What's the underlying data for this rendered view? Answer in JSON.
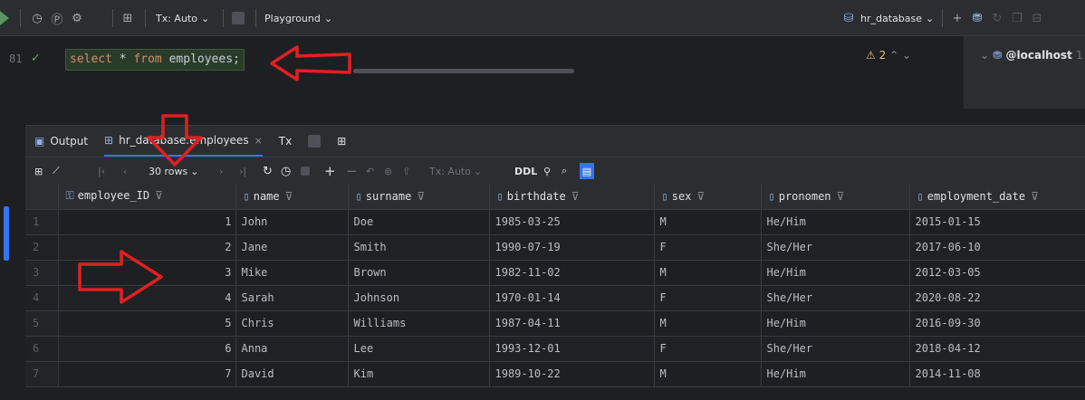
{
  "toolbar": {
    "tx_mode": "Tx: Auto",
    "playground": "Playground",
    "database": "hr_database"
  },
  "editor": {
    "line_number": "81",
    "query": {
      "kw1": "select",
      "star": " * ",
      "kw2": "from",
      "table": " employees",
      "semi": ";"
    },
    "warning_count": "2"
  },
  "right_panel": {
    "host": "@localhost",
    "host_suffix": "1"
  },
  "results": {
    "tabs": {
      "output": "Output",
      "table": "hr_database.employees",
      "tx": "Tx"
    },
    "toolbar": {
      "rows": "30 rows",
      "tx_mode": "Tx: Auto",
      "ddl": "DDL"
    },
    "columns": [
      "employee_ID",
      "name",
      "surname",
      "birthdate",
      "sex",
      "pronomen",
      "employment_date"
    ],
    "rows": [
      {
        "n": "1",
        "id": "1",
        "name": "John",
        "surname": "Doe",
        "birthdate": "1985-03-25",
        "sex": "M",
        "pronomen": "He/Him",
        "employment_date": "2015-01-15"
      },
      {
        "n": "2",
        "id": "2",
        "name": "Jane",
        "surname": "Smith",
        "birthdate": "1990-07-19",
        "sex": "F",
        "pronomen": "She/Her",
        "employment_date": "2017-06-10"
      },
      {
        "n": "3",
        "id": "3",
        "name": "Mike",
        "surname": "Brown",
        "birthdate": "1982-11-02",
        "sex": "M",
        "pronomen": "He/Him",
        "employment_date": "2012-03-05"
      },
      {
        "n": "4",
        "id": "4",
        "name": "Sarah",
        "surname": "Johnson",
        "birthdate": "1970-01-14",
        "sex": "F",
        "pronomen": "She/Her",
        "employment_date": "2020-08-22"
      },
      {
        "n": "5",
        "id": "5",
        "name": "Chris",
        "surname": "Williams",
        "birthdate": "1987-04-11",
        "sex": "M",
        "pronomen": "He/Him",
        "employment_date": "2016-09-30"
      },
      {
        "n": "6",
        "id": "6",
        "name": "Anna",
        "surname": "Lee",
        "birthdate": "1993-12-01",
        "sex": "F",
        "pronomen": "She/Her",
        "employment_date": "2018-04-12"
      },
      {
        "n": "7",
        "id": "7",
        "name": "David",
        "surname": "Kim",
        "birthdate": "1989-10-22",
        "sex": "M",
        "pronomen": "He/Him",
        "employment_date": "2014-11-08"
      }
    ]
  },
  "colors": {
    "annotation_arrow": "#e02020",
    "accent": "#3574f0",
    "keyword": "#cf8e6d"
  }
}
